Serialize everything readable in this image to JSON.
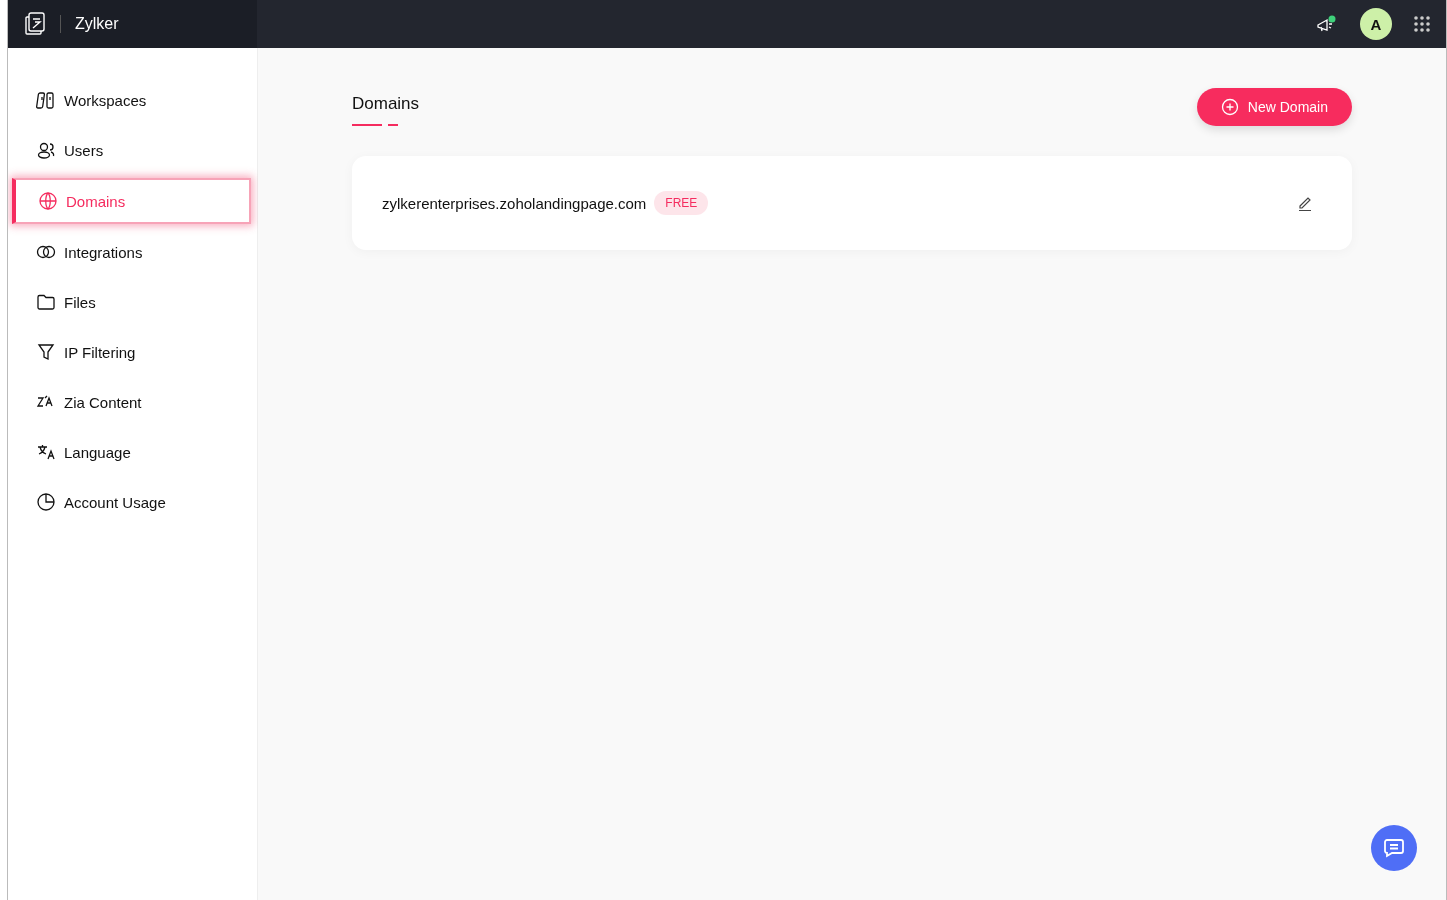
{
  "app": {
    "name": "Zylker"
  },
  "header": {
    "avatar_initial": "A",
    "notification_dot": true
  },
  "sidebar": {
    "items": [
      {
        "label": "Workspaces",
        "selected": false
      },
      {
        "label": "Users",
        "selected": false
      },
      {
        "label": "Domains",
        "selected": true
      },
      {
        "label": "Integrations",
        "selected": false
      },
      {
        "label": "Files",
        "selected": false
      },
      {
        "label": "IP Filtering",
        "selected": false
      },
      {
        "label": "Zia Content",
        "selected": false
      },
      {
        "label": "Language",
        "selected": false
      },
      {
        "label": "Account Usage",
        "selected": false
      }
    ]
  },
  "page": {
    "title": "Domains",
    "new_button": "New Domain"
  },
  "domains": [
    {
      "name": "zylkerenterprises.zoholandingpage.com",
      "badge": "FREE"
    }
  ]
}
